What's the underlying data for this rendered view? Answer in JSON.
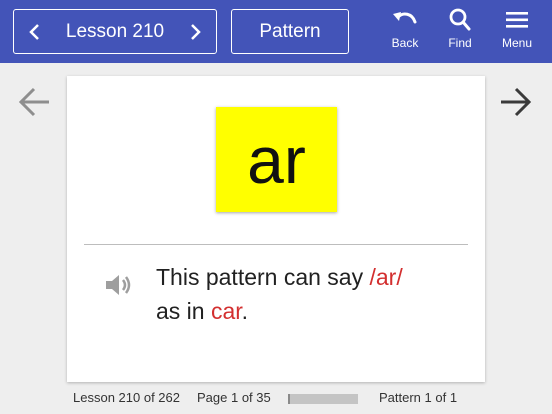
{
  "header": {
    "lesson_label": "Lesson 210",
    "pattern_label": "Pattern",
    "back_label": "Back",
    "find_label": "Find",
    "menu_label": "Menu"
  },
  "card": {
    "pattern": "ar",
    "sentence_prefix": "This pattern can say ",
    "sound": "/ar/",
    "sentence_mid": "as in ",
    "example_word": "car",
    "sentence_end": "."
  },
  "footer": {
    "lesson_status": "Lesson 210 of 262",
    "page_status": "Page 1 of 35",
    "pattern_status": "Pattern 1 of 1",
    "progress_fraction": 0.03
  },
  "colors": {
    "header_bg": "#4354b8",
    "tile_bg": "#ffff00",
    "highlight": "#d32f2f"
  },
  "icons": {
    "prev_lesson": "chevron-left-icon",
    "next_lesson": "chevron-right-icon",
    "back": "undo-arrow-icon",
    "find": "search-icon",
    "menu": "hamburger-menu-icon",
    "prev_page": "arrow-left-icon",
    "next_page": "arrow-right-icon",
    "audio": "speaker-icon"
  }
}
